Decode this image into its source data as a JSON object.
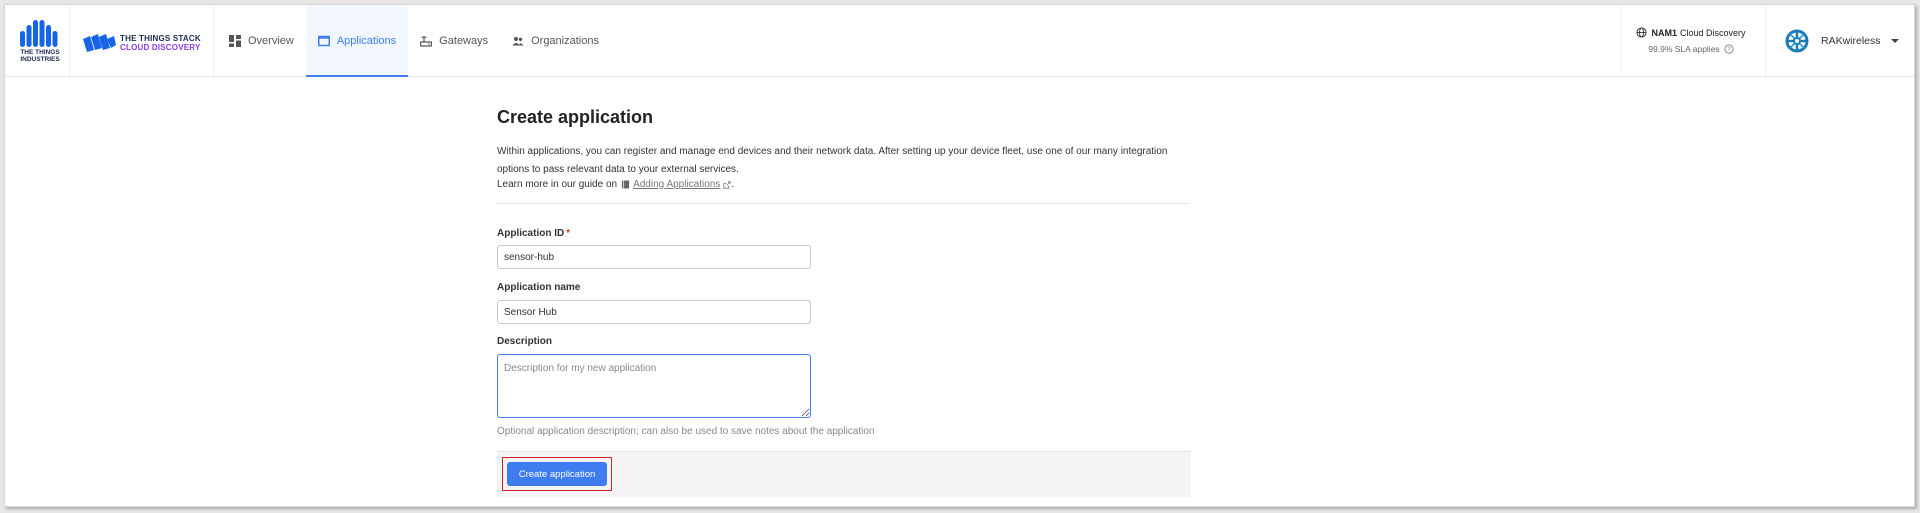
{
  "header": {
    "org_logo_line1": "THE THINGS",
    "org_logo_line2": "INDUSTRIES",
    "product_line1": "THE THINGS STACK",
    "product_line2": "CLOUD DISCOVERY",
    "nav": [
      {
        "label": "Overview",
        "icon": "dashboard-icon",
        "active": false
      },
      {
        "label": "Applications",
        "icon": "window-icon",
        "active": true
      },
      {
        "label": "Gateways",
        "icon": "router-icon",
        "active": false
      },
      {
        "label": "Organizations",
        "icon": "people-icon",
        "active": false
      }
    ],
    "cluster": {
      "name": "NAM1",
      "type": "Cloud Discovery",
      "sla": "99.9% SLA applies"
    },
    "user": {
      "name": "RAKwireless"
    }
  },
  "page": {
    "title": "Create application",
    "description": "Within applications, you can register and manage end devices and their network data. After setting up your device fleet, use one of our many integration options to pass relevant data to your external services.",
    "learn_prefix": "Learn more in our guide on",
    "learn_link": "Adding Applications",
    "learn_suffix": "."
  },
  "form": {
    "app_id": {
      "label": "Application ID",
      "required_mark": "*",
      "value": "sensor-hub"
    },
    "app_name": {
      "label": "Application name",
      "value": "Sensor Hub"
    },
    "description": {
      "label": "Description",
      "placeholder": "Description for my new application",
      "help": "Optional application description; can also be used to save notes about the application"
    },
    "submit_label": "Create application"
  },
  "colors": {
    "accent": "#3e7cf0",
    "required": "#e53935",
    "highlight": "#d01f2f",
    "brand_purple": "#8b3ee6"
  }
}
